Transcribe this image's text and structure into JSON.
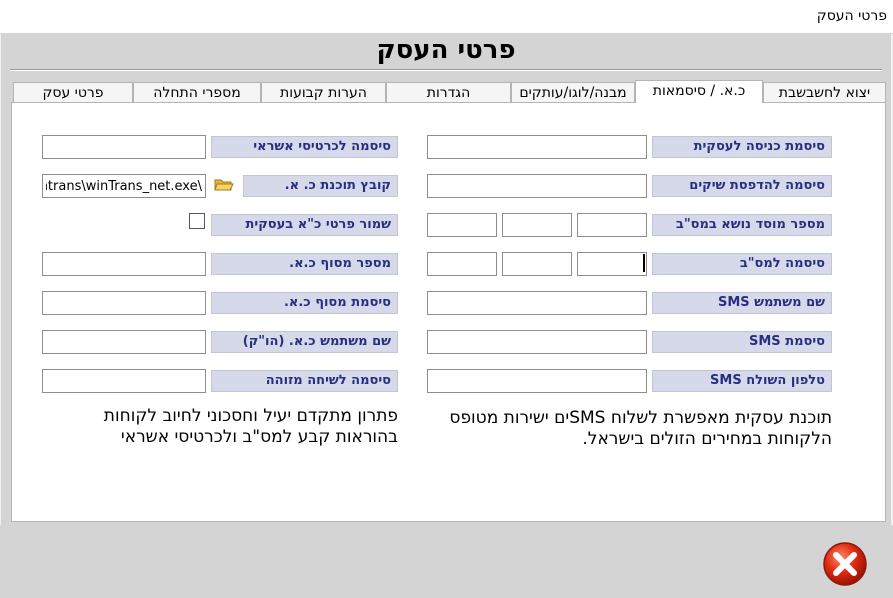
{
  "window": {
    "title": "פרטי העסק"
  },
  "header": {
    "title": "פרטי העסק"
  },
  "tabs": [
    {
      "label": "יצוא לחשבשבת",
      "active": false
    },
    {
      "label": "כ.א. / סיסמאות",
      "active": true
    },
    {
      "label": "מבנה/לוגו/עותקים",
      "active": false
    },
    {
      "label": "הגדרות",
      "active": false
    },
    {
      "label": "הערות קבועות",
      "active": false
    },
    {
      "label": "מספרי התחלה",
      "active": false
    },
    {
      "label": "פרטי עסק",
      "active": false
    }
  ],
  "right_fields": [
    {
      "label": "סיסמת כניסה לעסקית"
    },
    {
      "label": "סיסמה להדפסת שיקים"
    },
    {
      "label": "מספר מוסד נושא במס\"ב"
    },
    {
      "label": "סיסמה למס\"ב"
    },
    {
      "label": "שם משתמש SMS"
    },
    {
      "label": "סיסמת SMS"
    },
    {
      "label": "טלפון השולח SMS"
    }
  ],
  "left_fields": [
    {
      "label": "סיסמה לכרטיסי אשראי",
      "value": ""
    },
    {
      "label": "קובץ תוכנת כ. א.",
      "value": "\\Wintrans\\winTrans_net.exe"
    },
    {
      "label": "שמור פרטי כ\"א בעסקית",
      "checked": false
    },
    {
      "label": "מספר מסוף כ.א.",
      "value": ""
    },
    {
      "label": "סיסמת מסוף כ.א.",
      "value": ""
    },
    {
      "label": "שם משתמש כ.א. (הו\"ק)",
      "value": ""
    },
    {
      "label": "סיסמה לשיחה מזוהה",
      "value": ""
    }
  ],
  "descriptions": {
    "sms_line1": "תוכנת עסקית מאפשרת לשלוח SMSים ישירות מטופס",
    "sms_line2": "הלקוחות במחירים הזולים בישראל.",
    "cc_line1": "פתרון מתקדם יעיל וחסכוני לחיוב לקוחות",
    "cc_line2": "בהוראות קבע למס\"ב ולכרטיסי אשראי"
  },
  "icons": {
    "folder": "folder-open-icon",
    "close": "close-x-icon"
  },
  "colors": {
    "label_bg": "#d6d9ea",
    "label_text": "#273080",
    "close_red": "#e02a10"
  }
}
